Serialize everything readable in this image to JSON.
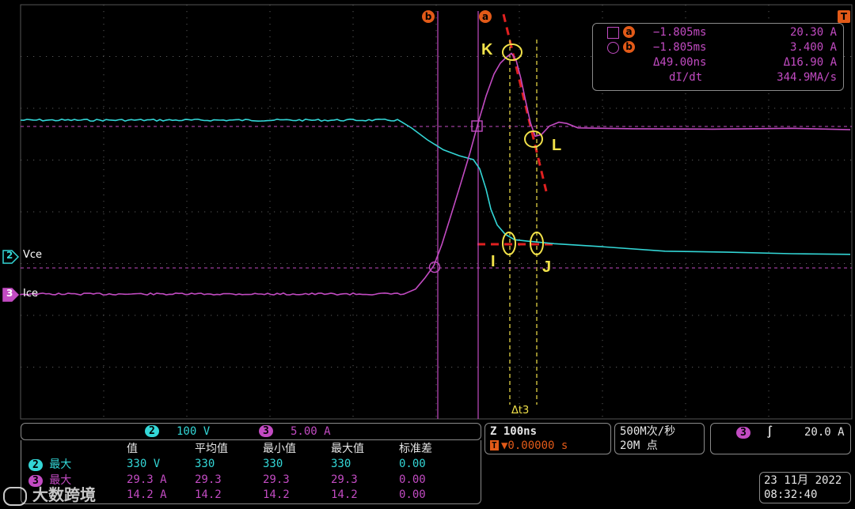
{
  "cursor_readout": {
    "a_time": "−1.805ms",
    "a_value": "20.30 A",
    "b_time": "−1.805ms",
    "b_value": "3.400 A",
    "delta_time": "Δ49.00ns",
    "delta_value": "Δ16.90 A",
    "rate_label": "dI/dt",
    "rate_value": "344.9MA/s"
  },
  "cursor_labels": {
    "a": "a",
    "b": "b"
  },
  "trigger_marker": "T",
  "annotations": {
    "K": "K",
    "L": "L",
    "I": "I",
    "J": "J",
    "dt": "Δt3"
  },
  "channels": {
    "ch2": {
      "num": "2",
      "label": "Vce",
      "scale": "100 V",
      "color": "#33d6d6"
    },
    "ch3": {
      "num": "3",
      "label": "Ice",
      "scale": "5.00 A",
      "color": "#c24bc2"
    }
  },
  "timebase": {
    "zoom": "Z 100ns",
    "position": "▼0.00000 s",
    "trig_icon": "T"
  },
  "acquisition": {
    "rate": "500M次/秒",
    "points": "20M 点"
  },
  "trigger": {
    "channel": "3",
    "slope": "∫",
    "level": "20.0 A"
  },
  "measurements": {
    "headers": [
      "值",
      "平均值",
      "最小值",
      "最大值",
      "标准差"
    ],
    "rows": [
      {
        "chip": "2",
        "label": "最大",
        "value": "330 V",
        "mean": "330",
        "min": "330",
        "max": "330",
        "std": "0.00",
        "color": "cyan"
      },
      {
        "chip": "3",
        "label": "最大",
        "value": "29.3 A",
        "mean": "29.3",
        "min": "29.3",
        "max": "29.3",
        "std": "0.00",
        "color": "mag"
      },
      {
        "chip": "",
        "label": "",
        "value": "14.2 A",
        "mean": "14.2",
        "min": "14.2",
        "max": "14.2",
        "std": "0.00",
        "color": "mag"
      }
    ]
  },
  "datetime": {
    "date": "23 11月 2022",
    "time": "08:32:40"
  },
  "watermark": "大数跨境",
  "colors": {
    "vce": "#33d6d6",
    "ice": "#c24bc2",
    "cursor": "#e25a18",
    "annotation": "#f2e24a",
    "fit_line": "#e02020"
  }
}
